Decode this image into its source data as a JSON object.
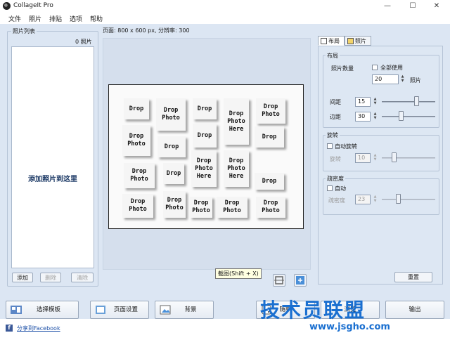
{
  "window": {
    "title": "CollageIt Pro",
    "minimize": "—",
    "maximize": "☐",
    "close": "✕"
  },
  "menu": [
    "文件",
    "照片",
    "排贴",
    "选项",
    "帮助"
  ],
  "photo_list": {
    "title": "照片列表",
    "count": "0 照片",
    "drop_hint": "添加照片到这里",
    "add": "添加",
    "remove": "删除",
    "clear": "清除"
  },
  "page_info": "页面: 800 x 600 px, 分辨率: 300",
  "collage_cells": [
    [
      "Drop"
    ],
    [
      "Drop",
      "Photo"
    ],
    [
      "Drop"
    ],
    [
      "Drop",
      "Photo",
      "Here"
    ],
    [
      "Drop",
      "Photo"
    ],
    [
      "Drop",
      "Photo"
    ],
    [
      "Drop"
    ],
    [
      "Drop"
    ],
    [
      "Drop"
    ],
    [
      "Drop",
      "Photo"
    ],
    [
      "Drop"
    ],
    [
      "Drop",
      "Photo",
      "Here"
    ],
    [
      "Drop",
      "Photo",
      "Here"
    ],
    [
      "Drop"
    ],
    [
      "Drop",
      "Photo"
    ],
    [
      "Drop",
      "Photo"
    ],
    [
      "Drop",
      "Photo"
    ],
    [
      "Drop",
      "Photo"
    ],
    [
      "Drop",
      "Photo"
    ]
  ],
  "tooltip": "截图(Shift + X)",
  "tabs": {
    "layout": "布局",
    "photo": "照片"
  },
  "layout": {
    "section": "布局",
    "photo_count_label": "照片数量",
    "use_all": "全部使用",
    "count_value": "20",
    "count_unit": "照片",
    "spacing_label": "间距",
    "spacing_value": "15",
    "margin_label": "边距",
    "margin_value": "30"
  },
  "rotation": {
    "section": "旋转",
    "auto": "自动旋转",
    "label": "旋转",
    "value": "10"
  },
  "density": {
    "section": "疏密度",
    "auto": "自动",
    "label": "疏密度",
    "value": "23"
  },
  "reset": "重置",
  "bottom": {
    "template": "选择模板",
    "page_setup": "页面设置",
    "background": "背景",
    "random": "随机",
    "preview": "浏览",
    "export": "输出"
  },
  "facebook": "分享到Facebook",
  "watermark": {
    "cn": "技术员联盟",
    "url": "www.jsgho.com"
  }
}
